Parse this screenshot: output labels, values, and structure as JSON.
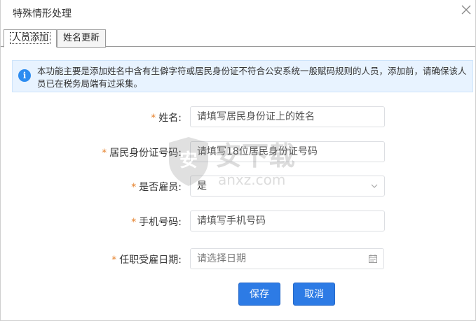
{
  "window": {
    "title": "特殊情形处理"
  },
  "tabs": [
    {
      "label": "人员添加",
      "active": true
    },
    {
      "label": "姓名更新",
      "active": false
    }
  ],
  "notice": {
    "icon": "info-icon",
    "text": "本功能主要是添加姓名中含有生僻字符或居民身份证不符合公安系统一般赋码规则的人员，添加前，请确保该人员已在税务局端有过采集。"
  },
  "form": {
    "required_mark": "*",
    "fields": [
      {
        "label": "姓名:",
        "placeholder": "请填写居民身份证上的姓名"
      },
      {
        "label": "居民身份证号码:",
        "placeholder": "请填写18位居民身份证号码"
      },
      {
        "label": "是否雇员:",
        "value": "是"
      },
      {
        "label": "手机号码:",
        "placeholder": "请填写手机号码"
      },
      {
        "label": "任职受雇日期:",
        "placeholder": "请选择日期"
      }
    ]
  },
  "buttons": {
    "save": "保存",
    "cancel": "取消"
  },
  "watermark": {
    "text": "安下载",
    "subtext": "anxz.com"
  },
  "colors": {
    "primary": "#2d7be5",
    "required": "#e6812a",
    "info_bg": "#e8f3ff"
  }
}
